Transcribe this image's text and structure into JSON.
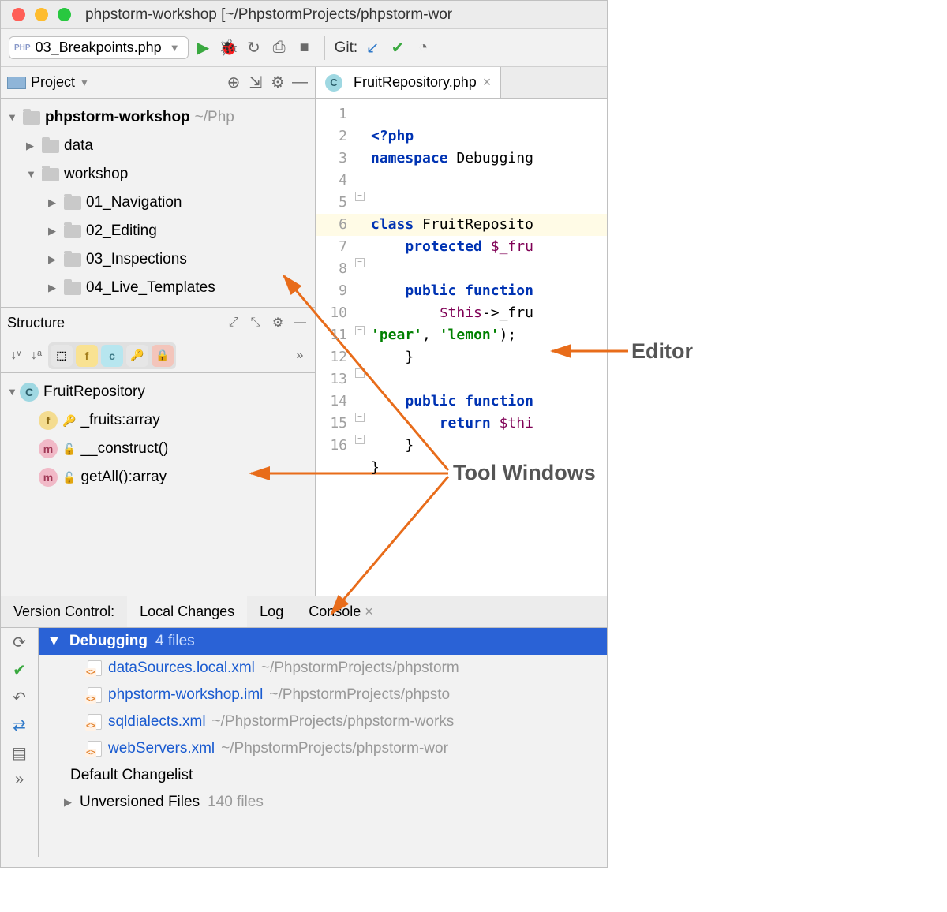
{
  "window": {
    "title": "phpstorm-workshop [~/PhpstormProjects/phpstorm-wor"
  },
  "toolbar": {
    "run_config": "03_Breakpoints.php",
    "git_label": "Git:"
  },
  "project": {
    "header": "Project",
    "root": {
      "name": "phpstorm-workshop",
      "path": "~/Php"
    },
    "items": [
      {
        "name": "data",
        "level": 1,
        "expanded": false
      },
      {
        "name": "workshop",
        "level": 1,
        "expanded": true
      },
      {
        "name": "01_Navigation",
        "level": 2,
        "expanded": false
      },
      {
        "name": "02_Editing",
        "level": 2,
        "expanded": false
      },
      {
        "name": "03_Inspections",
        "level": 2,
        "expanded": false
      },
      {
        "name": "04_Live_Templates",
        "level": 2,
        "expanded": false
      }
    ]
  },
  "structure": {
    "header": "Structure",
    "class_name": "FruitRepository",
    "members": [
      {
        "kind": "f",
        "vis": "key",
        "label": "_fruits:array"
      },
      {
        "kind": "m",
        "vis": "lock",
        "label": "__construct()"
      },
      {
        "kind": "m",
        "vis": "lock",
        "label": "getAll():array"
      }
    ]
  },
  "tab": {
    "file": "FruitRepository.php"
  },
  "code": {
    "lines": [
      "<?php",
      "namespace Debugging",
      "",
      "",
      "class FruitRepositor",
      "    protected $_fru",
      "",
      "    public function",
      "        $this->_fru",
      "'pear', 'lemon');",
      "    }",
      "",
      "    public function",
      "        return $thi",
      "    }",
      "}",
      ""
    ],
    "line_numbers": [
      "1",
      "2",
      "3",
      "4",
      "5",
      "6",
      "7",
      "8",
      "9",
      "",
      "10",
      "11",
      "12",
      "13",
      "14",
      "15",
      "16"
    ]
  },
  "vc": {
    "title": "Version Control:",
    "tabs": [
      "Local Changes",
      "Log",
      "Console"
    ],
    "changelist": {
      "name": "Debugging",
      "count": "4 files"
    },
    "files": [
      {
        "name": "dataSources.local.xml",
        "path": "~/PhpstormProjects/phpstorm"
      },
      {
        "name": "phpstorm-workshop.iml",
        "path": "~/PhpstormProjects/phpsto"
      },
      {
        "name": "sqldialects.xml",
        "path": "~/PhpstormProjects/phpstorm-works"
      },
      {
        "name": "webServers.xml",
        "path": "~/PhpstormProjects/phpstorm-wor"
      }
    ],
    "default_cl": "Default Changelist",
    "unversioned": {
      "label": "Unversioned Files",
      "count": "140 files"
    }
  },
  "annotations": {
    "editor": "Editor",
    "tool_windows": "Tool Windows"
  }
}
